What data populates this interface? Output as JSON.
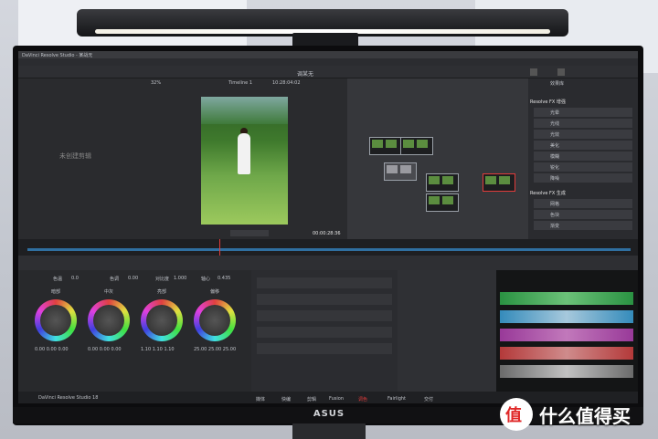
{
  "app": {
    "window_title": "DaVinci Resolve Studio - 某战无",
    "project_title": "调某无",
    "timeline_name": "Timeline 1",
    "zoom": "32%",
    "timecode_top": "10:28:04:02",
    "timecode_viewer": "00:00:28:36",
    "clip_label": "未创建剪辑",
    "brand_label": "DaVinci Resolve Studio 18",
    "screen_label": "ASUS"
  },
  "right_panel": {
    "header": "效果库",
    "section_1": "Resolve FX 增强",
    "section_2": "Resolve FX 生成",
    "items_1": [
      "光晕",
      "光线",
      "光效",
      "美化",
      "模糊",
      "锐化",
      "降噪"
    ],
    "items_2": [
      "网格",
      "色块",
      "渐变"
    ]
  },
  "pages": [
    "媒体",
    "快编",
    "剪辑",
    "Fusion",
    "调色",
    "Fairlight",
    "交付"
  ],
  "active_page": "调色",
  "wheels": {
    "labels": [
      "暗部",
      "中灰",
      "亮部",
      "偏移"
    ],
    "values": [
      "0.00 0.00 0.00",
      "0.00 0.00 0.00",
      "1.10 1.10 1.10",
      "25.00 25.00 25.00"
    ],
    "temp_label": "色温",
    "temp_value": "0.0",
    "tint_label": "色调",
    "tint_value": "0.00",
    "contrast_label": "对比度",
    "contrast_value": "1.000",
    "pivot_label": "轴心",
    "pivot_value": "0.435"
  },
  "watermark": {
    "text": "什么值得买",
    "icon": "值"
  },
  "colors": {
    "accent": "#e23b3b",
    "playhead": "#e23b3b",
    "ui_dark": "#232427"
  }
}
